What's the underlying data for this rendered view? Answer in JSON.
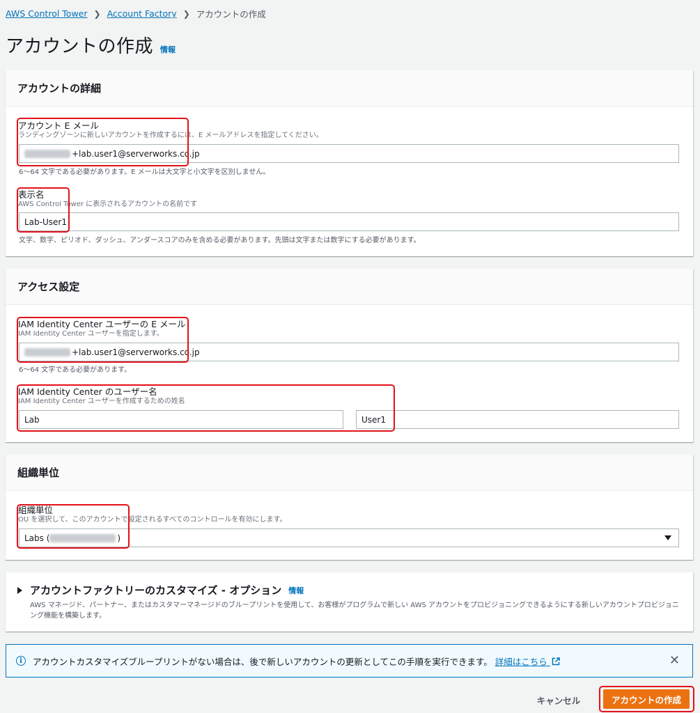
{
  "breadcrumb": {
    "items": [
      "AWS Control Tower",
      "Account Factory"
    ],
    "current": "アカウントの作成"
  },
  "page": {
    "title": "アカウントの作成",
    "info": "情報"
  },
  "account_details": {
    "header": "アカウントの詳細",
    "email": {
      "label": "アカウント E メール",
      "description": "ランディングゾーンに新しいアカウントを作成するには、E メールアドレスを指定してください。",
      "value": "+lab.user1@serverworks.co.jp",
      "hint": "6～64 文字である必要があります。E メールは大文字と小文字を区別しません。"
    },
    "display_name": {
      "label": "表示名",
      "description": "AWS Control Tower に表示されるアカウントの名前です",
      "value": "Lab-User1",
      "hint": "文字、数字、ピリオド、ダッシュ、アンダースコアのみを含める必要があります。先頭は文字または数字にする必要があります。"
    }
  },
  "access": {
    "header": "アクセス設定",
    "email": {
      "label": "IAM Identity Center ユーザーの E メール",
      "description": "IAM Identity Center ユーザーを指定します。",
      "value": "+lab.user1@serverworks.co.jp",
      "hint": "6～64 文字である必要があります。"
    },
    "user_name": {
      "label": "IAM Identity Center のユーザー名",
      "description": "IAM Identity Center ユーザーを作成するための姓名",
      "first": "Lab",
      "last": "User1"
    }
  },
  "ou": {
    "header": "組織単位",
    "field": {
      "label": "組織単位",
      "description": "OU を選択して、このアカウントで設定されるすべてのコントロールを有効にします。",
      "value_prefix": "Labs (",
      "value_suffix": ")"
    }
  },
  "customize": {
    "title": "アカウントファクトリーのカスタマイズ - オプション",
    "info": "情報",
    "description": "AWS マネージド、パートナー、またはカスタマーマネージドのブループリントを使用して、お客様がプログラムで新しい AWS アカウントをプロビジョニングできるようにする新しいアカウントプロビジョニング機能を構築します。"
  },
  "alert": {
    "text": "アカウントカスタマイズブループリントがない場合は、後で新しいアカウントの更新としてこの手順を実行できます。",
    "link": "詳細はこちら"
  },
  "actions": {
    "cancel": "キャンセル",
    "create": "アカウントの作成"
  },
  "colors": {
    "primary": "#ec7211",
    "link": "#0073bb",
    "highlight": "#e3101a"
  }
}
